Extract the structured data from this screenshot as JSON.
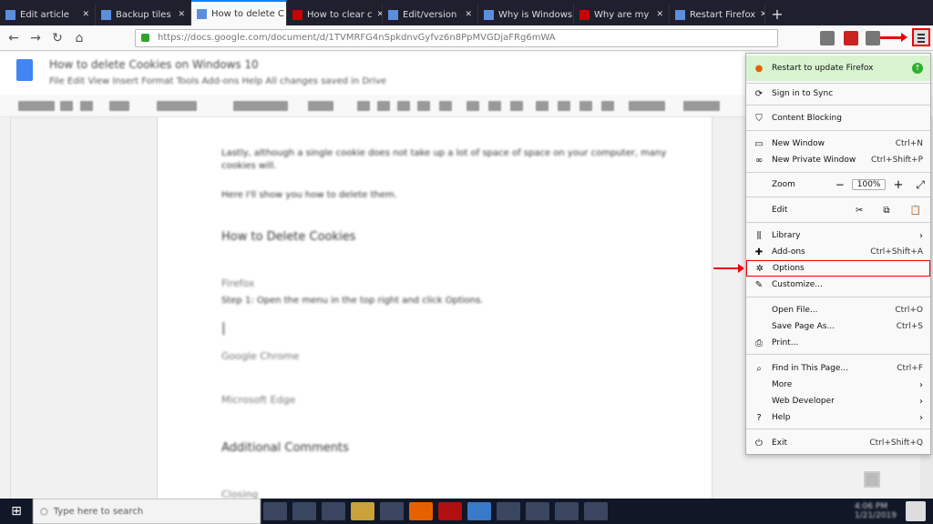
{
  "browser": {
    "tabs": [
      {
        "label": "Edit article"
      },
      {
        "label": "Backup tiles"
      },
      {
        "label": "How to delete C"
      },
      {
        "label": "How to clear c"
      },
      {
        "label": "Edit/version"
      },
      {
        "label": "Why is Windows"
      },
      {
        "label": "Why are my"
      },
      {
        "label": "Restart Firefox"
      }
    ],
    "new_tab_label": "+",
    "url": "https://docs.google.com/document/d/1TVMRFG4nSpkdnvGyfvz6n8PpMVGDjaFRg6mWA"
  },
  "doc": {
    "title": "How to delete Cookies on Windows 10",
    "menu": "File   Edit   View   Insert   Format   Tools   Add-ons   Help   All changes saved in Drive",
    "lines": [
      "Lastly, although a single cookie does not take up a lot of space of space on your computer, many",
      "cookies will.",
      "Here I'll show you how to delete them.",
      "How to Delete Cookies",
      "Firefox",
      "Step 1: Open the menu in the top right and click Options.",
      "|",
      "Google Chrome",
      "Microsoft Edge",
      "Additional Comments",
      "Closing"
    ]
  },
  "menu": {
    "update": "Restart to update Firefox",
    "sync": "Sign in to Sync",
    "content_blocking": "Content Blocking",
    "new_window": "New Window",
    "new_window_sc": "Ctrl+N",
    "private_window": "New Private Window",
    "private_window_sc": "Ctrl+Shift+P",
    "zoom": "Zoom",
    "zoom_minus": "−",
    "zoom_value": "100%",
    "zoom_plus": "+",
    "fullscreen": "⤢",
    "edit": "Edit",
    "cut": "✂",
    "copy": "⧉",
    "paste": "📋",
    "library": "Library",
    "addons": "Add-ons",
    "addons_sc": "Ctrl+Shift+A",
    "options": "Options",
    "customize": "Customize...",
    "open_file": "Open File...",
    "open_file_sc": "Ctrl+O",
    "save_page": "Save Page As...",
    "save_page_sc": "Ctrl+S",
    "print": "Print...",
    "find": "Find in This Page...",
    "find_sc": "Ctrl+F",
    "more": "More",
    "web_dev": "Web Developer",
    "help": "Help",
    "exit": "Exit",
    "exit_sc": "Ctrl+Shift+Q"
  },
  "taskbar": {
    "search_placeholder": "Type here to search",
    "tray_time": "4:06 PM",
    "tray_date": "1/21/2019"
  },
  "colors": {
    "highlight": "#ee0000",
    "update_bg": "#d8f3d0"
  }
}
